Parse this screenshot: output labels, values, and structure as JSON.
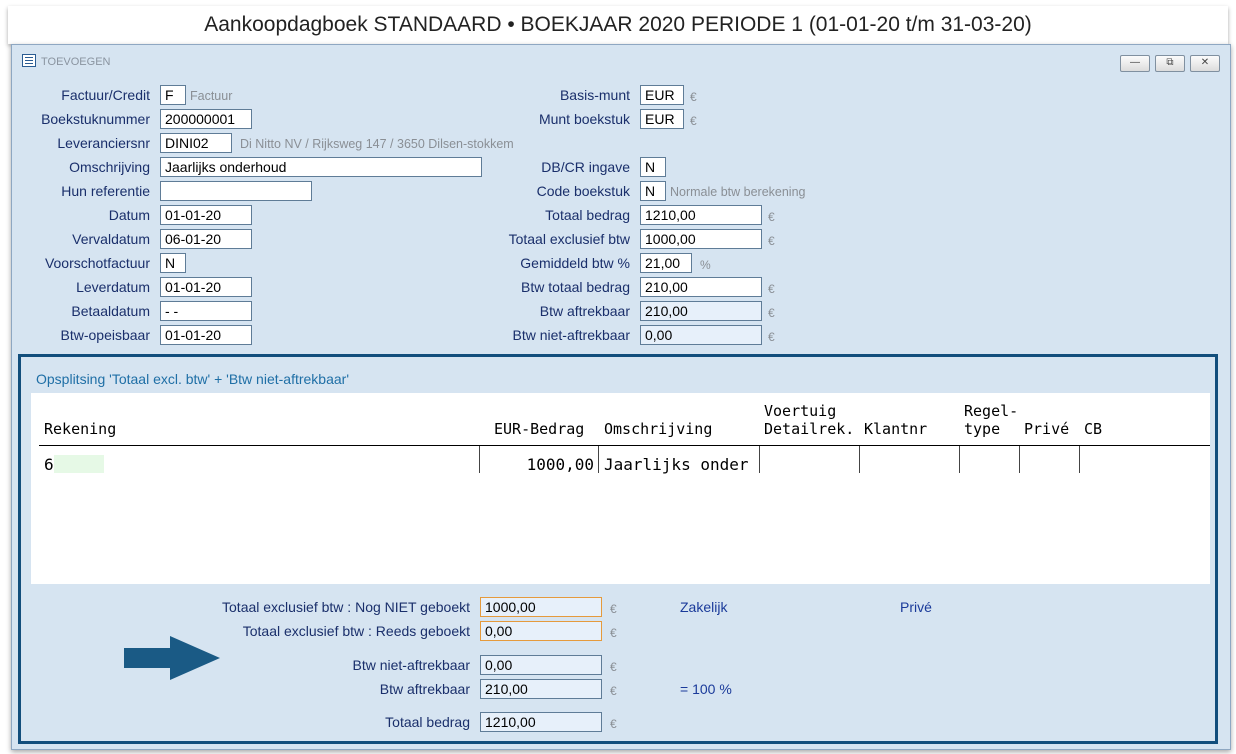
{
  "app_title": "Aankoopdagboek STANDAARD • BOEKJAAR 2020 PERIODE 1 (01-01-20 t/m 31-03-20)",
  "window": {
    "title": "TOEVOEGEN",
    "minimize": "—",
    "restore": "⧉",
    "close": "✕"
  },
  "left": {
    "factuur_credit": {
      "label": "Factuur/Credit",
      "value": "F",
      "hint": "Factuur"
    },
    "boekstuknummer": {
      "label": "Boekstuknummer",
      "value": "200000001"
    },
    "leveranciersnr": {
      "label": "Leveranciersnr",
      "value": "DINI02",
      "hint": "Di Nitto NV / Rijksweg 147 / 3650 Dilsen-stokkem"
    },
    "omschrijving": {
      "label": "Omschrijving",
      "value": "Jaarlijks onderhoud"
    },
    "hun_referentie": {
      "label": "Hun referentie",
      "value": ""
    },
    "datum": {
      "label": "Datum",
      "value": "01-01-20"
    },
    "vervaldatum": {
      "label": "Vervaldatum",
      "value": "06-01-20"
    },
    "voorschotfactuur": {
      "label": "Voorschotfactuur",
      "value": "N"
    },
    "leverdatum": {
      "label": "Leverdatum",
      "value": "01-01-20"
    },
    "betaaldatum": {
      "label": "Betaaldatum",
      "value": "- -"
    },
    "btw_opeisbaar": {
      "label": "Btw-opeisbaar",
      "value": "01-01-20"
    }
  },
  "right": {
    "basis_munt": {
      "label": "Basis-munt",
      "value": "EUR",
      "unit": "€"
    },
    "munt_boekstuk": {
      "label": "Munt boekstuk",
      "value": "EUR",
      "unit": "€"
    },
    "dbcr_ingave": {
      "label": "DB/CR ingave",
      "value": "N"
    },
    "code_boekstuk": {
      "label": "Code boekstuk",
      "value": "N",
      "hint": "Normale btw berekening"
    },
    "totaal_bedrag": {
      "label": "Totaal bedrag",
      "value": "1210,00",
      "unit": "€"
    },
    "totaal_excl": {
      "label": "Totaal exclusief btw",
      "value": "1000,00",
      "unit": "€"
    },
    "gem_btw": {
      "label": "Gemiddeld btw %",
      "value": "21,00",
      "unit": "%"
    },
    "btw_totaal": {
      "label": "Btw totaal bedrag",
      "value": "210,00",
      "unit": "€"
    },
    "btw_aftrek": {
      "label": "Btw aftrekbaar",
      "value": "210,00",
      "unit": "€"
    },
    "btw_niet_aftrek": {
      "label": "Btw niet-aftrekbaar",
      "value": "0,00",
      "unit": "€"
    }
  },
  "split": {
    "title": "Opsplitsing 'Totaal excl. btw' + 'Btw niet-aftrekbaar'",
    "headers": {
      "rekening": "Rekening",
      "eur_bedrag": "EUR-Bedrag",
      "omschrijving": "Omschrijving",
      "voertuig_top": "Voertuig",
      "detailrek": "Detailrek.",
      "klantnr": "Klantnr",
      "regel_top": "Regel-",
      "regel_bottom": "type",
      "prive": "Privé",
      "cb": "CB"
    },
    "rows": [
      {
        "rekening": "6",
        "bedrag": "1000,00",
        "omschrijving": "Jaarlijks onder"
      }
    ]
  },
  "totals": {
    "nog_niet": {
      "label": "Totaal exclusief btw : Nog NIET geboekt",
      "value": "1000,00",
      "unit": "€"
    },
    "reeds": {
      "label": "Totaal exclusief btw : Reeds geboekt",
      "value": "0,00",
      "unit": "€"
    },
    "btw_niet_aftrek": {
      "label": "Btw niet-aftrekbaar",
      "value": "0,00",
      "unit": "€"
    },
    "btw_aftrek": {
      "label": "Btw aftrekbaar",
      "value": "210,00",
      "unit": "€"
    },
    "totaal": {
      "label": "Totaal bedrag",
      "value": "1210,00",
      "unit": "€"
    },
    "zakelijk": "Zakelijk",
    "prive": "Privé",
    "pct": "= 100 %"
  }
}
